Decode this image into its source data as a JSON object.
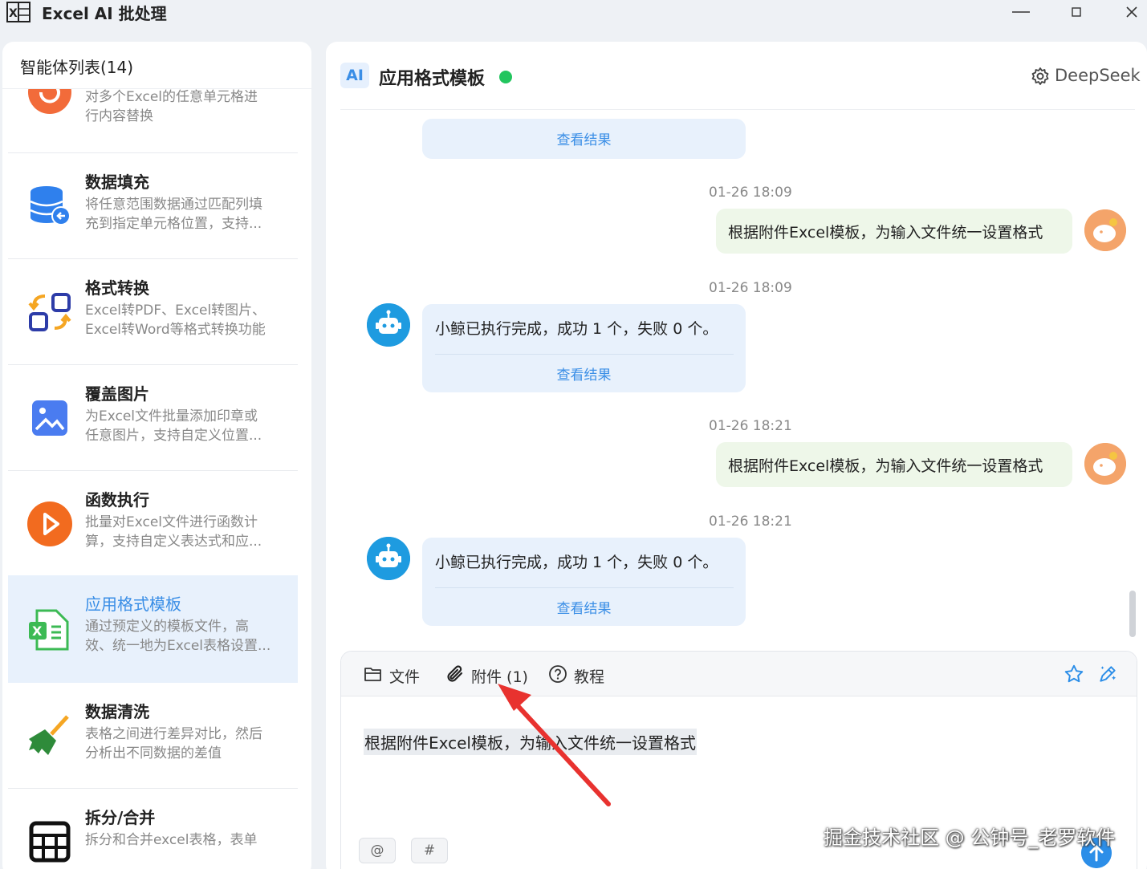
{
  "app": {
    "title": "Excel AI 批处理"
  },
  "sidebar": {
    "header": "智能体列表(14)",
    "items": [
      {
        "title": "",
        "desc": "对多个Excel的任意单元格进行内容替换",
        "desc_line1": "对多个Excel的任意单元格进",
        "desc_line2": "行内容替换",
        "icon": "refresh-icon",
        "color": "#f26b3a"
      },
      {
        "title": "数据填充",
        "desc_line1": "将任意范围数据通过匹配列填",
        "desc_line2": "充到指定单元格位置，支持...",
        "icon": "database-import-icon",
        "color": "#2f80ed"
      },
      {
        "title": "格式转换",
        "desc_line1": "Excel转PDF、Excel转图片、",
        "desc_line2": "Excel转Word等格式转换功能",
        "icon": "convert-icon",
        "color": "#2d3ca8"
      },
      {
        "title": "覆盖图片",
        "desc_line1": "为Excel文件批量添加印章或",
        "desc_line2": "任意图片，支持自定义位置...",
        "icon": "image-icon",
        "color": "#4a7cf0"
      },
      {
        "title": "函数执行",
        "desc_line1": "批量对Excel文件进行函数计",
        "desc_line2": "算，支持自定义表达式和应...",
        "icon": "play-icon",
        "color": "#f26b1f"
      },
      {
        "title": "应用格式模板",
        "desc_line1": "通过预定义的模板文件，高",
        "desc_line2": "效、统一地为Excel表格设置...",
        "icon": "excel-template-icon",
        "color": "#3cba54",
        "active": true
      },
      {
        "title": "数据清洗",
        "desc_line1": "表格之间进行差异对比，然后",
        "desc_line2": "分析出不同数据的差值",
        "icon": "broom-icon",
        "color": "#2e8b3a"
      },
      {
        "title": "拆分/合并",
        "desc_line1": "拆分和合并excel表格，表单",
        "desc_line2": "",
        "icon": "grid-split-icon",
        "color": "#111111"
      }
    ]
  },
  "chat": {
    "badge": "AI",
    "title": "应用格式模板",
    "model": "DeepSeek",
    "view_result": "查看结果",
    "messages": [
      {
        "time": "01-26 18:09",
        "user": "根据附件Excel模板，为输入文件统一设置格式",
        "bot": "小鲸已执行完成，成功 1 个，失败 0 个。"
      },
      {
        "time": "01-26 18:21",
        "user": "根据附件Excel模板，为输入文件统一设置格式",
        "bot": "小鲸已执行完成，成功 1 个，失败 0 个。"
      }
    ],
    "bot_time_1": "01-26 18:09",
    "bot_time_2": "01-26 18:21"
  },
  "composer": {
    "file_label": "文件",
    "attach_label": "附件 (1)",
    "tutorial_label": "教程",
    "text": "根据附件Excel模板，为输入文件统一设置格式",
    "chip_at": "@",
    "chip_hash": "#"
  },
  "watermark": "掘金技术社区 @ 公钟号_老罗软件",
  "colors": {
    "accent": "#3a8ee6",
    "online": "#22c55e",
    "annotation_arrow": "#e8322f"
  }
}
